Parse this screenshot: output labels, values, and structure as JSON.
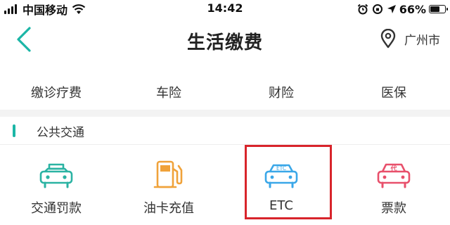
{
  "status_bar": {
    "carrier": "中国移动",
    "time": "14:42",
    "battery_text": "66%",
    "battery_level": 0.66
  },
  "nav": {
    "title": "生活缴费",
    "city": "广州市"
  },
  "top_row": [
    {
      "label": "缴诊疗费",
      "icon": "medical-bill-icon"
    },
    {
      "label": "车险",
      "icon": "car-insurance-icon"
    },
    {
      "label": "财险",
      "icon": "property-insurance-icon"
    },
    {
      "label": "医保",
      "icon": "health-insurance-icon"
    }
  ],
  "section": {
    "title": "公共交通"
  },
  "transport_items": [
    {
      "label": "交通罚款",
      "icon": "traffic-fine-icon",
      "color": "#2bb3a3"
    },
    {
      "label": "油卡充值",
      "icon": "fuel-card-icon",
      "color": "#f0a23a"
    },
    {
      "label": "ETC",
      "icon": "etc-car-icon",
      "icon_text": "ETC",
      "color": "#3aa7e8"
    },
    {
      "label": "票款",
      "icon": "ticket-payment-icon",
      "icon_text": "代",
      "color": "#e8506b"
    }
  ],
  "colors": {
    "accent": "#1bb6a6",
    "highlight": "#d8242b"
  }
}
